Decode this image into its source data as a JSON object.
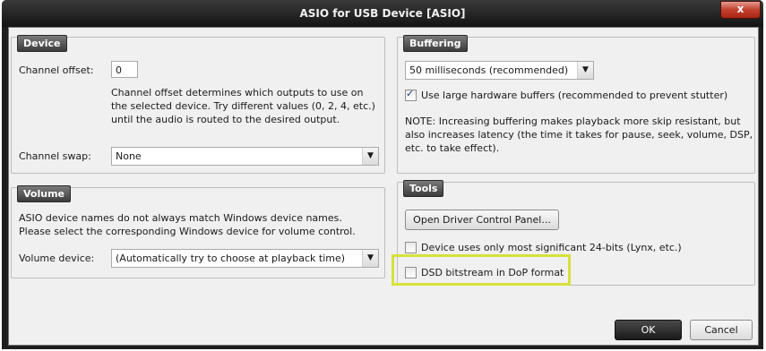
{
  "window": {
    "title": "ASIO for USB Device [ASIO]",
    "close_glyph": "x"
  },
  "device": {
    "group_title": "Device",
    "channel_offset_label": "Channel offset:",
    "channel_offset_value": "0",
    "channel_offset_desc": [
      "Channel offset determines which outputs to use on",
      "the selected device.  Try different values (0, 2, 4, etc.)",
      "until the audio is routed to the desired output."
    ],
    "channel_swap_label": "Channel swap:",
    "channel_swap_value": "None"
  },
  "volume": {
    "group_title": "Volume",
    "desc": [
      "ASIO device names do not always match Windows device names.",
      "Please select the corresponding Windows device for volume control."
    ],
    "device_label": "Volume device:",
    "device_value": "(Automatically try to choose at playback time)"
  },
  "buffering": {
    "group_title": "Buffering",
    "buffer_value": "50 milliseconds (recommended)",
    "large_buffers_label": "Use large hardware buffers (recommended to prevent stutter)",
    "large_buffers_checked": true,
    "note": [
      "NOTE: Increasing buffering makes playback more skip resistant, but",
      "also increases latency (the time it takes for pause, seek, volume, DSP,",
      "etc. to take effect)."
    ]
  },
  "tools": {
    "group_title": "Tools",
    "driver_button": "Open Driver Control Panel...",
    "msb24_label": "Device uses only most significant 24-bits (Lynx, etc.)",
    "dop_label": "DSD bitstream in DoP format",
    "highlight_color": "#d5e23b"
  },
  "footer": {
    "ok": "OK",
    "cancel": "Cancel"
  }
}
